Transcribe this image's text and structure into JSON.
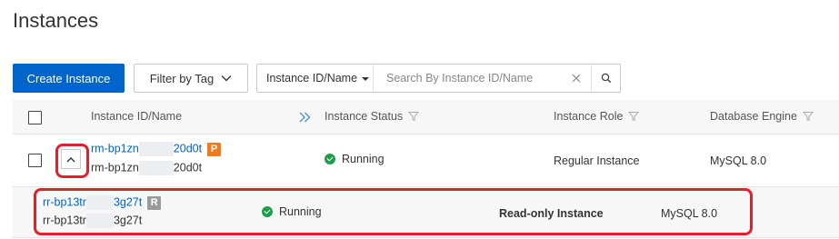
{
  "page": {
    "title": "Instances"
  },
  "toolbar": {
    "create_label": "Create Instance",
    "filter_label": "Filter by Tag",
    "search_field_label": "Instance ID/Name",
    "search_placeholder": "Search By Instance ID/Name"
  },
  "table": {
    "columns": {
      "id_name": "Instance ID/Name",
      "status": "Instance Status",
      "role": "Instance Role",
      "engine": "Database Engine"
    },
    "rows": [
      {
        "id_prefix": "rm-bp1zn",
        "id_suffix": "20d0t",
        "name_prefix": "rm-bp1zn",
        "name_suffix": "20d0t",
        "badge": "P",
        "status": "Running",
        "role": "Regular Instance",
        "engine": "MySQL 8.0"
      },
      {
        "id_prefix": "rr-bp13tr",
        "id_suffix": "3g27t",
        "name_prefix": "rr-bp13tr",
        "name_suffix": "3g27t",
        "badge": "R",
        "status": "Running",
        "role": "Read-only Instance",
        "engine": "MySQL 8.0"
      }
    ]
  },
  "colors": {
    "primary": "#0064c8",
    "running": "#1e9e4a",
    "badge_primary": "#f07b1d",
    "badge_readonly": "#9b9b9b",
    "highlight": "#e0202c"
  }
}
